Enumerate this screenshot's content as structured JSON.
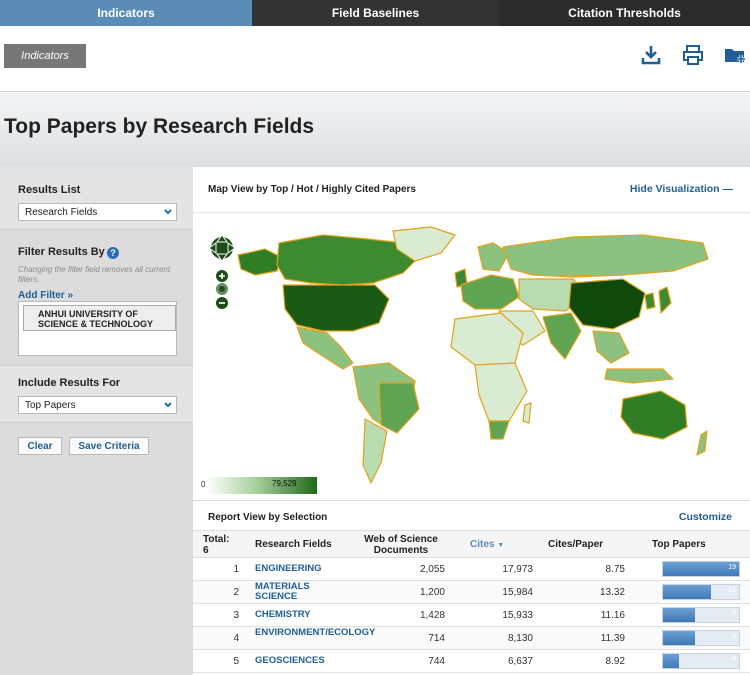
{
  "topnav": {
    "tabs": [
      {
        "label": "Indicators"
      },
      {
        "label": "Field Baselines"
      },
      {
        "label": "Citation Thresholds"
      }
    ]
  },
  "toolbar": {
    "breadcrumb": "Indicators",
    "icons": [
      "download-icon",
      "print-icon",
      "add-folder-icon"
    ]
  },
  "page": {
    "title": "Top Papers by Research Fields"
  },
  "sidebar": {
    "results_list_label": "Results List",
    "results_list_value": "Research Fields",
    "filter_label": "Filter Results By",
    "filter_hint": "Changing the filter field removes all current filters.",
    "add_filter": "Add Filter »",
    "filter_value": "ANHUI UNIVERSITY OF SCIENCE & TECHNOLOGY",
    "include_label": "Include Results For",
    "include_value": "Top Papers",
    "clear_label": "Clear",
    "save_label": "Save Criteria"
  },
  "map": {
    "title": "Map View by Top / Hot / Highly Cited Papers",
    "hide_label": "Hide Visualization",
    "legend_min": "0",
    "legend_max": "79,529",
    "colors": {
      "light": "#d9ecd2",
      "mid": "#8cc27f",
      "dark": "#2f7d24",
      "darkest": "#1a5a14",
      "border": "#e3a21a"
    }
  },
  "report": {
    "title": "Report View by Selection",
    "customize": "Customize",
    "headers": {
      "total": "Total: 6",
      "field": "Research Fields",
      "docs": "Web of Science Documents",
      "cites": "Cites",
      "cpp": "Cites/Paper",
      "top": "Top Papers"
    },
    "rows": [
      {
        "rank": "1",
        "field": "ENGINEERING",
        "docs": "2,055",
        "cites": "17,973",
        "cpp": "8.75",
        "top": "19",
        "top_frac": 1.0
      },
      {
        "rank": "2",
        "field": "MATERIALS SCIENCE",
        "docs": "1,200",
        "cites": "15,984",
        "cpp": "13.32",
        "top": "12",
        "top_frac": 0.63
      },
      {
        "rank": "3",
        "field": "CHEMISTRY",
        "docs": "1,428",
        "cites": "15,933",
        "cpp": "11.16",
        "top": "8",
        "top_frac": 0.42
      },
      {
        "rank": "4",
        "field": "ENVIRONMENT/ECOLOGY",
        "docs": "714",
        "cites": "8,130",
        "cpp": "11.39",
        "top": "8",
        "top_frac": 0.42
      },
      {
        "rank": "5",
        "field": "GEOSCIENCES",
        "docs": "744",
        "cites": "6,637",
        "cpp": "8.92",
        "top": "4",
        "top_frac": 0.21
      }
    ]
  }
}
